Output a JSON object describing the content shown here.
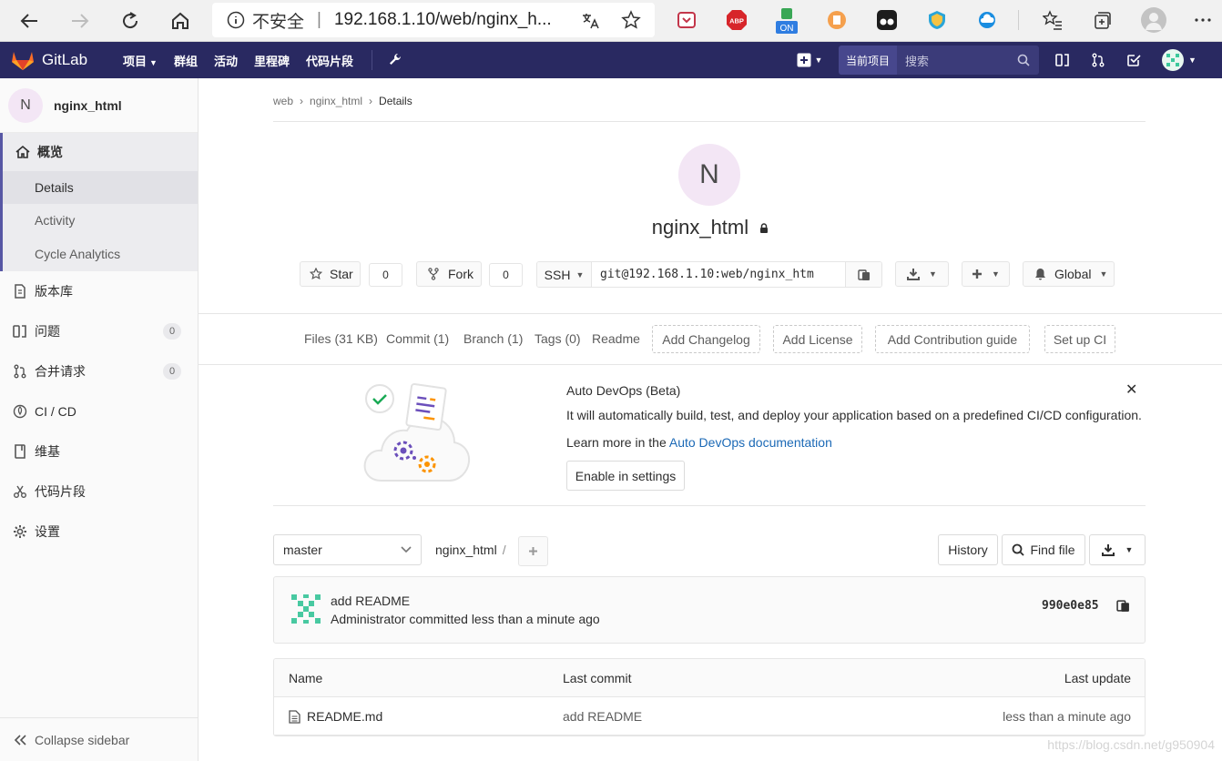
{
  "browser": {
    "security_label": "不安全",
    "url": "192.168.1.10/web/nginx_h..."
  },
  "nav": {
    "brand": "GitLab",
    "menu": [
      {
        "label": "项目",
        "caret": true
      },
      {
        "label": "群组",
        "caret": false
      },
      {
        "label": "活动",
        "caret": false
      },
      {
        "label": "里程碑",
        "caret": false
      },
      {
        "label": "代码片段",
        "caret": false
      }
    ],
    "search_scope": "当前项目",
    "search_placeholder": "搜索"
  },
  "sidebar": {
    "project_initial": "N",
    "project_name": "nginx_html",
    "overview": {
      "label": "概览",
      "sub": [
        "Details",
        "Activity",
        "Cycle Analytics"
      ]
    },
    "items": [
      {
        "label": "版本库",
        "icon": "doc-icon"
      },
      {
        "label": "问题",
        "icon": "issues-icon",
        "count": "0"
      },
      {
        "label": "合并请求",
        "icon": "merge-icon",
        "count": "0"
      },
      {
        "label": "CI / CD",
        "icon": "rocket-icon"
      },
      {
        "label": "维基",
        "icon": "book-icon"
      },
      {
        "label": "代码片段",
        "icon": "scissors-icon"
      },
      {
        "label": "设置",
        "icon": "gear-icon"
      }
    ],
    "collapse": "Collapse sidebar"
  },
  "breadcrumb": [
    "web",
    "nginx_html",
    "Details"
  ],
  "project": {
    "initial": "N",
    "name": "nginx_html",
    "star_label": "Star",
    "star_count": "0",
    "fork_label": "Fork",
    "fork_count": "0",
    "clone_protocol": "SSH",
    "clone_url": "git@192.168.1.10:web/nginx_htm",
    "notification": "Global"
  },
  "stats": {
    "files": "Files (31 KB)",
    "commit": "Commit (1)",
    "branch": "Branch (1)",
    "tags": "Tags (0)",
    "readme": "Readme",
    "add_changelog": "Add Changelog",
    "add_license": "Add License",
    "add_contribution": "Add Contribution guide",
    "setup_ci": "Set up CI"
  },
  "devops": {
    "title": "Auto DevOps (Beta)",
    "description": "It will automatically build, test, and deploy your application based on a predefined CI/CD configuration.",
    "learn_prefix": "Learn more in the ",
    "learn_link": "Auto DevOps documentation",
    "enable": "Enable in settings"
  },
  "repo": {
    "branch": "master",
    "path": "nginx_html",
    "path_sep": "/",
    "history": "History",
    "find_file": "Find file"
  },
  "last_commit": {
    "message": "add README",
    "meta": "Administrator committed less than a minute ago",
    "sha": "990e0e85"
  },
  "files_table": {
    "headers": [
      "Name",
      "Last commit",
      "Last update"
    ],
    "rows": [
      {
        "name": "README.md",
        "commit": "add README",
        "updated": "less than a minute ago"
      }
    ]
  },
  "watermark": "https://blog.csdn.net/g950904",
  "colors": {
    "navbar": "#292961",
    "link": "#1b69b6",
    "avatar_bg": "#f3e6f5"
  }
}
